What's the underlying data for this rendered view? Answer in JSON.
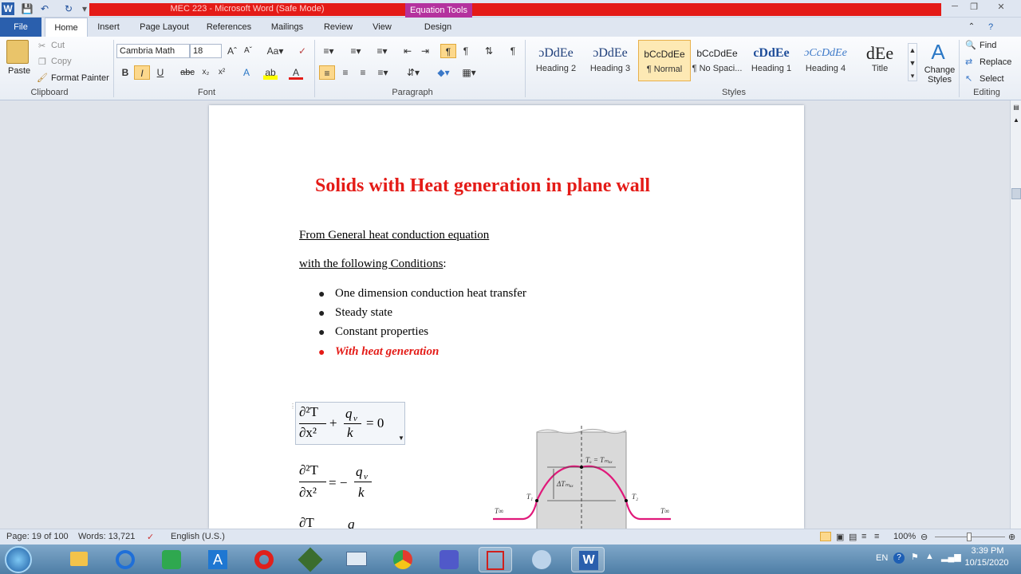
{
  "app": {
    "window_title": "MEC 223  -  Microsoft Word (Safe Mode)",
    "contextual_tab": "Equation Tools"
  },
  "tabs": [
    {
      "label": "File"
    },
    {
      "label": "Home"
    },
    {
      "label": "Insert"
    },
    {
      "label": "Page Layout"
    },
    {
      "label": "References"
    },
    {
      "label": "Mailings"
    },
    {
      "label": "Review"
    },
    {
      "label": "View"
    },
    {
      "label": "Design"
    }
  ],
  "clipboard": {
    "paste": "Paste",
    "cut": "Cut",
    "copy": "Copy",
    "format_painter": "Format Painter",
    "group": "Clipboard"
  },
  "font": {
    "name": "Cambria Math",
    "size": "18",
    "group": "Font"
  },
  "paragraph": {
    "group": "Paragraph"
  },
  "styles": {
    "group": "Styles",
    "items": [
      {
        "sample": "ɔDdEe",
        "name": "Heading 2"
      },
      {
        "sample": "ɔDdEe",
        "name": "Heading 3"
      },
      {
        "sample": "bCcDdEe",
        "name": "¶ Normal"
      },
      {
        "sample": "bCcDdEe",
        "name": "¶ No Spaci..."
      },
      {
        "sample": "cDdEe",
        "name": "Heading 1"
      },
      {
        "sample": "ɔCcDdEe",
        "name": "Heading 4"
      },
      {
        "sample": "dEe",
        "name": "Title"
      }
    ],
    "change": "Change Styles"
  },
  "editing": {
    "group": "Editing",
    "find": "Find",
    "replace": "Replace",
    "select": "Select"
  },
  "doc": {
    "title": "Solids with Heat generation in plane wall",
    "line1": "From General heat conduction equation",
    "line2a": "with the following Conditions",
    "line2b": ":",
    "bullets": [
      "One dimension conduction heat transfer",
      "Steady state",
      "Constant properties"
    ],
    "bullet_emph": "With heat generation",
    "eq1": {
      "num": "∂²T",
      "den": "∂x²",
      "plus": "+",
      "qnum": "q",
      "qsub": "v",
      "qden": "k",
      "rhs": "= 0"
    },
    "eq2": {
      "num": "∂²T",
      "den": "∂x²",
      "eq": "= −",
      "qnum": "q",
      "qsub": "v",
      "qden": "k"
    },
    "eq3": {
      "num": "∂T",
      "q": "q"
    },
    "fig": {
      "tmax": "Tₒ = Tₘₐₓ",
      "dtmax": "ΔTₘₐₓ",
      "t1": "T₁",
      "t2": "T₂",
      "tinf": "T∞",
      "tinf2": "T∞"
    }
  },
  "status": {
    "page": "Page: 19 of 100",
    "words": "Words: 13,721",
    "language": "English (U.S.)",
    "zoom": "100%"
  },
  "tray": {
    "lang": "EN",
    "time": "3:39 PM",
    "date": "10/15/2020"
  },
  "colors": {
    "title_red": "#e41b17",
    "accent_blue": "#2a5fad",
    "contextual": "#b4329e"
  }
}
